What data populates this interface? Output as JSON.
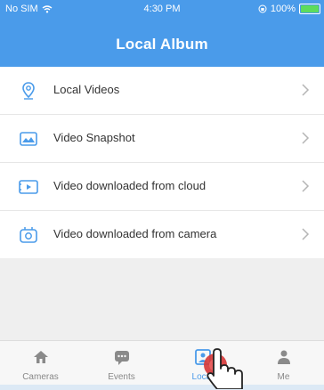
{
  "status_bar": {
    "carrier": "No SIM",
    "time": "4:30 PM",
    "battery": "100%",
    "battery_level": 1.0
  },
  "header": {
    "title": "Local Album"
  },
  "list": [
    {
      "label": "Local Videos",
      "icon": "pin-icon"
    },
    {
      "label": "Video Snapshot",
      "icon": "image-icon"
    },
    {
      "label": "Video downloaded from cloud",
      "icon": "video-icon"
    },
    {
      "label": "Video downloaded from camera",
      "icon": "camera-album-icon"
    }
  ],
  "tabs": [
    {
      "label": "Cameras",
      "icon": "home-icon",
      "active": false
    },
    {
      "label": "Events",
      "icon": "message-icon",
      "active": false
    },
    {
      "label": "Local",
      "icon": "album-icon",
      "active": true
    },
    {
      "label": "Me",
      "icon": "person-icon",
      "active": false
    }
  ],
  "colors": {
    "accent": "#4a9bea",
    "battery": "#5ddc5d",
    "touch": "#d63a3a"
  }
}
